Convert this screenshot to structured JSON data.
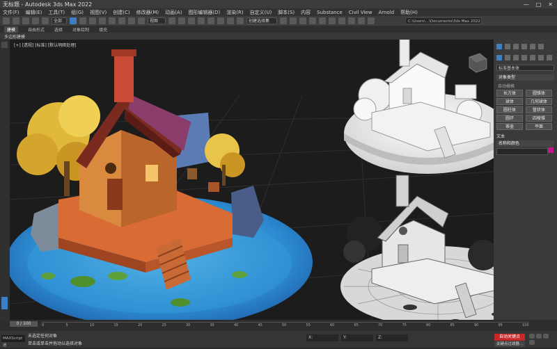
{
  "window": {
    "title": "无标题 - Autodesk 3ds Max 2022",
    "minimize": "—",
    "maximize": "□",
    "close": "✕"
  },
  "signin": {
    "label": "登录"
  },
  "menu": [
    "文件(F)",
    "编辑(E)",
    "工具(T)",
    "组(G)",
    "视图(V)",
    "创建(C)",
    "修改器(M)",
    "动画(A)",
    "图形编辑器(D)",
    "渲染(R)",
    "自定义(U)",
    "脚本(S)",
    "内容",
    "Substance",
    "Civil View",
    "Arnold",
    "帮助(H)"
  ],
  "toolbar": {
    "selection_filter": "全部",
    "view_dropdown": "视图",
    "named_set": "创建选择集"
  },
  "path_field": "C:\\Users\\...\\Documents\\3ds Max 2022",
  "ribbon": {
    "tabs": [
      "建模",
      "自由形式",
      "选择",
      "对象绘制",
      "填充"
    ],
    "active": "建模",
    "sub_label": "多边形建模"
  },
  "viewport": {
    "label": "[+] [透视] [标准] [默认明暗处理]"
  },
  "right_panel": {
    "dropdown": "标准基本体",
    "object_type_header": "对象类型",
    "autogrid": "自动栅格",
    "buttons": [
      "长方体",
      "圆锥体",
      "球体",
      "几何球体",
      "圆柱体",
      "管状体",
      "圆环",
      "四棱锥",
      "茶壶",
      "平面"
    ],
    "name_color_label": "名称和颜色",
    "text_fragment": "文本",
    "swatch_color": "#c0168a"
  },
  "timeline": {
    "frame_label": "0 / 100",
    "ticks": [
      "0",
      "5",
      "10",
      "15",
      "20",
      "25",
      "30",
      "35",
      "40",
      "45",
      "50",
      "55",
      "60",
      "65",
      "70",
      "75",
      "80",
      "85",
      "90",
      "95",
      "100"
    ]
  },
  "status": {
    "maxscript": "MAXScript 迷",
    "line1": "未选定任何对象",
    "line2": "单击或单击并拖动以选择对象",
    "x_label": "X:",
    "y_label": "Y:",
    "z_label": "Z:",
    "autokey": "自动关键点",
    "key_filter": "关键点过滤器..."
  },
  "colors": {
    "accent": "#3e7fc4",
    "autokey": "#c62828"
  }
}
